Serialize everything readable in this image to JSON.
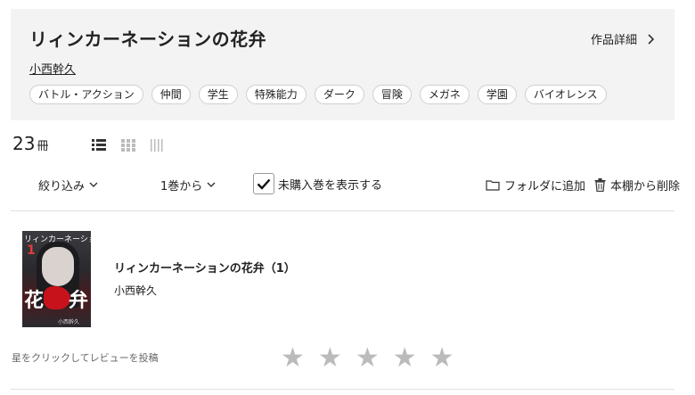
{
  "series": {
    "title": "リィンカーネーションの花弁",
    "detail_link": "作品詳細",
    "author": "小西幹久",
    "tags": [
      "バトル・アクション",
      "仲間",
      "学生",
      "特殊能力",
      "ダーク",
      "冒険",
      "メガネ",
      "学園",
      "バイオレンス"
    ]
  },
  "count": {
    "value": "23",
    "unit": "冊"
  },
  "toolbar": {
    "filter": "絞り込み",
    "sort": "1巻から",
    "show_unpurchased": "未購入巻を表示する",
    "show_unpurchased_checked": true,
    "add_folder": "フォルダに追加",
    "remove_shelf": "本棚から削除"
  },
  "book": {
    "title": "リィンカーネーションの花弁（1）",
    "author": "小西幹久",
    "cover_title": "リィンカーネーションの",
    "cover_volume": "1",
    "cover_kanji_left": "花",
    "cover_kanji_right": "弁",
    "cover_author": "小西幹久"
  },
  "review": {
    "prompt": "星をクリックしてレビューを投稿",
    "stars": 5,
    "star_color": "#bbbbbb"
  }
}
